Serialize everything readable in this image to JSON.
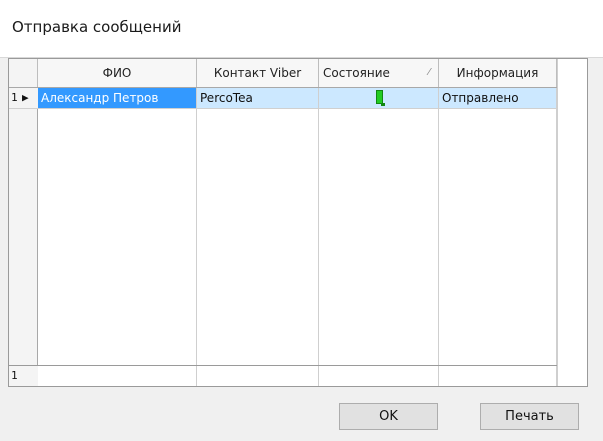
{
  "window": {
    "title": "Отправка сообщений"
  },
  "grid": {
    "columns": [
      {
        "label": "ФИО"
      },
      {
        "label": "Контакт Viber"
      },
      {
        "label": "Состояние",
        "sort_glyph": "⁄"
      },
      {
        "label": "Информация"
      }
    ],
    "rows": [
      {
        "number": "1",
        "fio": "Александр Петров",
        "viber": "PercoTea",
        "status_icon": "green-flag-icon",
        "info": "Отправлено"
      }
    ],
    "footer": {
      "number": "1"
    }
  },
  "buttons": {
    "ok": "OK",
    "print": "Печать"
  },
  "colors": {
    "selection": "#3399ff",
    "status_green": "#22cc22"
  }
}
